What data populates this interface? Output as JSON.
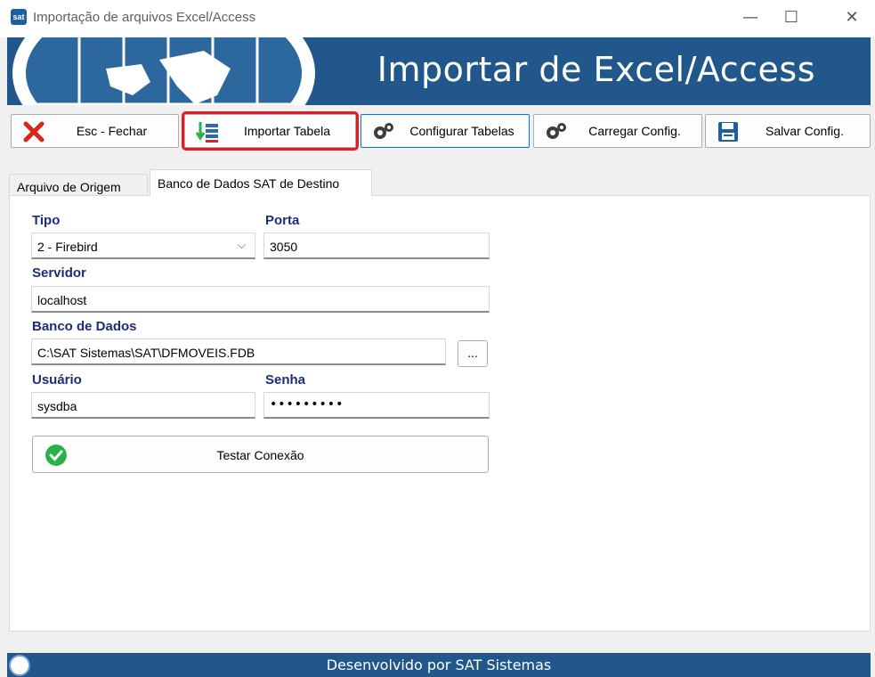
{
  "window": {
    "title": "Importação de arquivos Excel/Access",
    "app_icon_text": "sat"
  },
  "banner": {
    "title": "Importar de Excel/Access"
  },
  "toolbar": {
    "fechar_label": "Esc - Fechar",
    "importar_label": "Importar Tabela",
    "configurar_label": "Configurar Tabelas",
    "carregar_label": "Carregar Config.",
    "salvar_label": "Salvar Config.",
    "highlight_color": "#e31b23"
  },
  "tabs": [
    {
      "label": "Arquivo de Origem",
      "active": false
    },
    {
      "label": "Banco de Dados SAT de Destino",
      "active": true
    }
  ],
  "form": {
    "tipo_label": "Tipo",
    "tipo_value": "2 - Firebird",
    "porta_label": "Porta",
    "porta_value": "3050",
    "servidor_label": "Servidor",
    "servidor_value": "localhost",
    "banco_label": "Banco de Dados",
    "banco_value": "C:\\SAT Sistemas\\SAT\\DFMOVEIS.FDB",
    "browse_label": "...",
    "usuario_label": "Usuário",
    "usuario_value": "sysdba",
    "senha_label": "Senha",
    "senha_value": "•••••••••",
    "testar_label": "Testar Conexão"
  },
  "footer": {
    "text": "Desenvolvido por SAT Sistemas"
  },
  "colors": {
    "banner": "#21578a",
    "label": "#1c2d7a",
    "success": "#27b24a"
  }
}
